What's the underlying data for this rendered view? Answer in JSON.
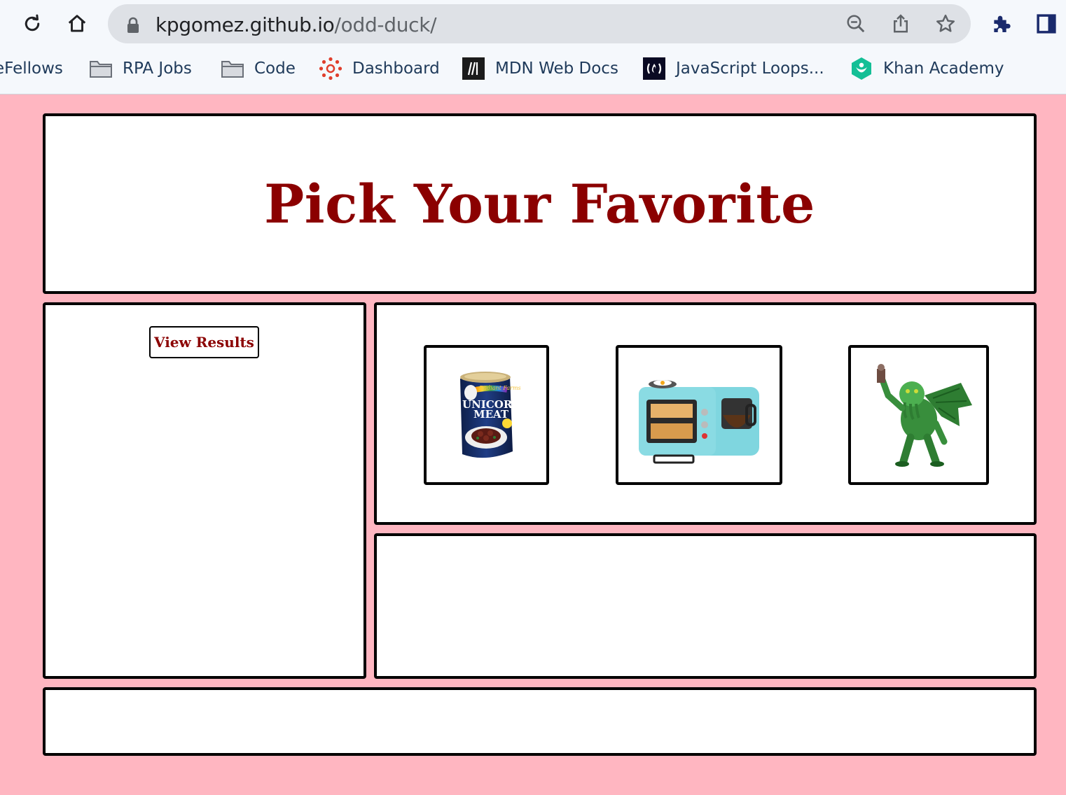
{
  "browser": {
    "url_host": "kpgomez.github.io",
    "url_path": "/odd-duck/",
    "bookmarks": [
      {
        "label": "eFellows",
        "icon": "none"
      },
      {
        "label": "RPA Jobs",
        "icon": "folder-icon"
      },
      {
        "label": "Code",
        "icon": "folder-icon"
      },
      {
        "label": "Dashboard",
        "icon": "canvas-icon"
      },
      {
        "label": "MDN Web Docs",
        "icon": "mdn-icon"
      },
      {
        "label": "JavaScript Loops...",
        "icon": "freecodecamp-icon"
      },
      {
        "label": "Khan Academy",
        "icon": "khan-academy-icon"
      }
    ]
  },
  "page": {
    "title": "Pick Your Favorite",
    "view_results_label": "View Results",
    "products": [
      {
        "name": "unicorn-meat",
        "can_brand": "Radiant Farms",
        "can_text_1": "UNICORN",
        "can_text_2": "MEAT"
      },
      {
        "name": "breakfast-station"
      },
      {
        "name": "cthulhu"
      }
    ]
  },
  "colors": {
    "background": "#ffb6c1",
    "title": "#8b0000",
    "border": "#000000"
  }
}
